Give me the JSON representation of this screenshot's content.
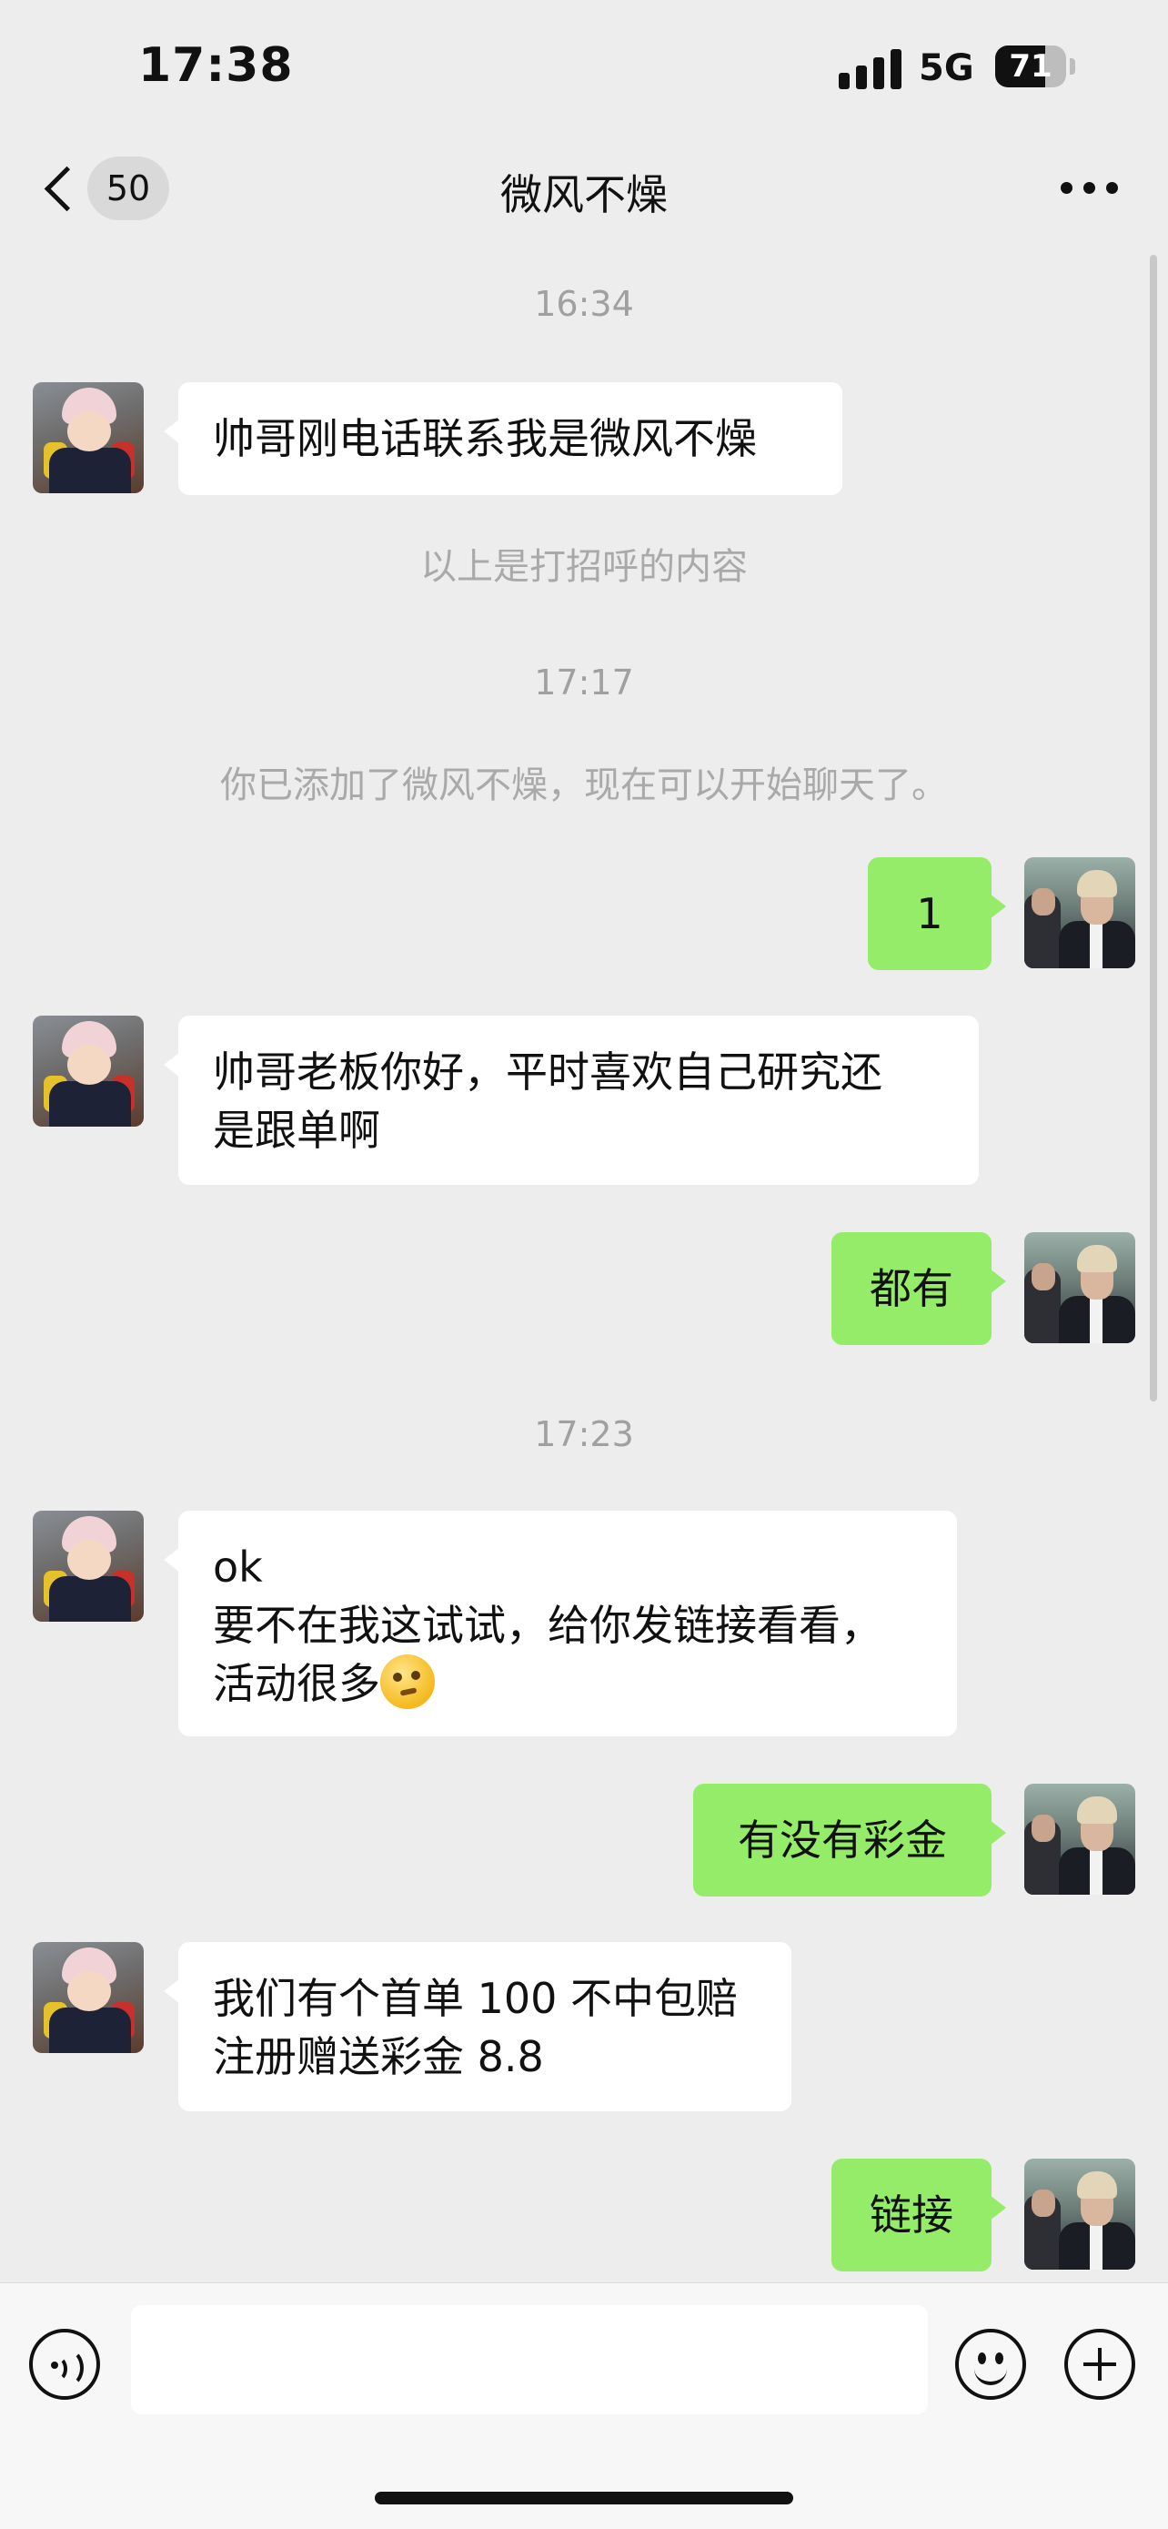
{
  "status_bar": {
    "time": "17:38",
    "network": "5G",
    "battery": "71",
    "battery_level": 0.71
  },
  "nav": {
    "back_icon": "chevron-left-icon",
    "unread_count": "50",
    "title": "微风不燥",
    "more_icon": "ellipsis-icon"
  },
  "chat": {
    "timestamps": [
      "16:34",
      "17:17",
      "17:23"
    ],
    "system_messages": [
      "以上是打招呼的内容",
      "你已添加了微风不燥，现在可以开始聊天了。"
    ],
    "messages": [
      {
        "side": "in",
        "lines": [
          "帅哥刚电话联系我是微风不燥"
        ]
      },
      {
        "side": "out",
        "lines": [
          "1"
        ]
      },
      {
        "side": "in",
        "lines": [
          "帅哥老板你好，平时喜欢自己研究还",
          "是跟单啊"
        ]
      },
      {
        "side": "out",
        "lines": [
          "都有"
        ]
      },
      {
        "side": "in",
        "lines": [
          "ok",
          "要不在我这试试，给你发链接看看，",
          "活动很多"
        ],
        "emoji": "thinking-face-emoji"
      },
      {
        "side": "out",
        "lines": [
          "有没有彩金"
        ]
      },
      {
        "side": "in",
        "lines": [
          "我们有个首单 100 不中包赔",
          "注册赠送彩金 8.8"
        ]
      },
      {
        "side": "out",
        "lines": [
          "链接"
        ]
      }
    ]
  },
  "input_bar": {
    "voice_icon": "voice-icon",
    "emoji_icon": "smiley-icon",
    "plus_icon": "plus-icon"
  },
  "colors": {
    "background": "#ededed",
    "outgoing_bubble": "#95ec69",
    "incoming_bubble": "#ffffff"
  }
}
